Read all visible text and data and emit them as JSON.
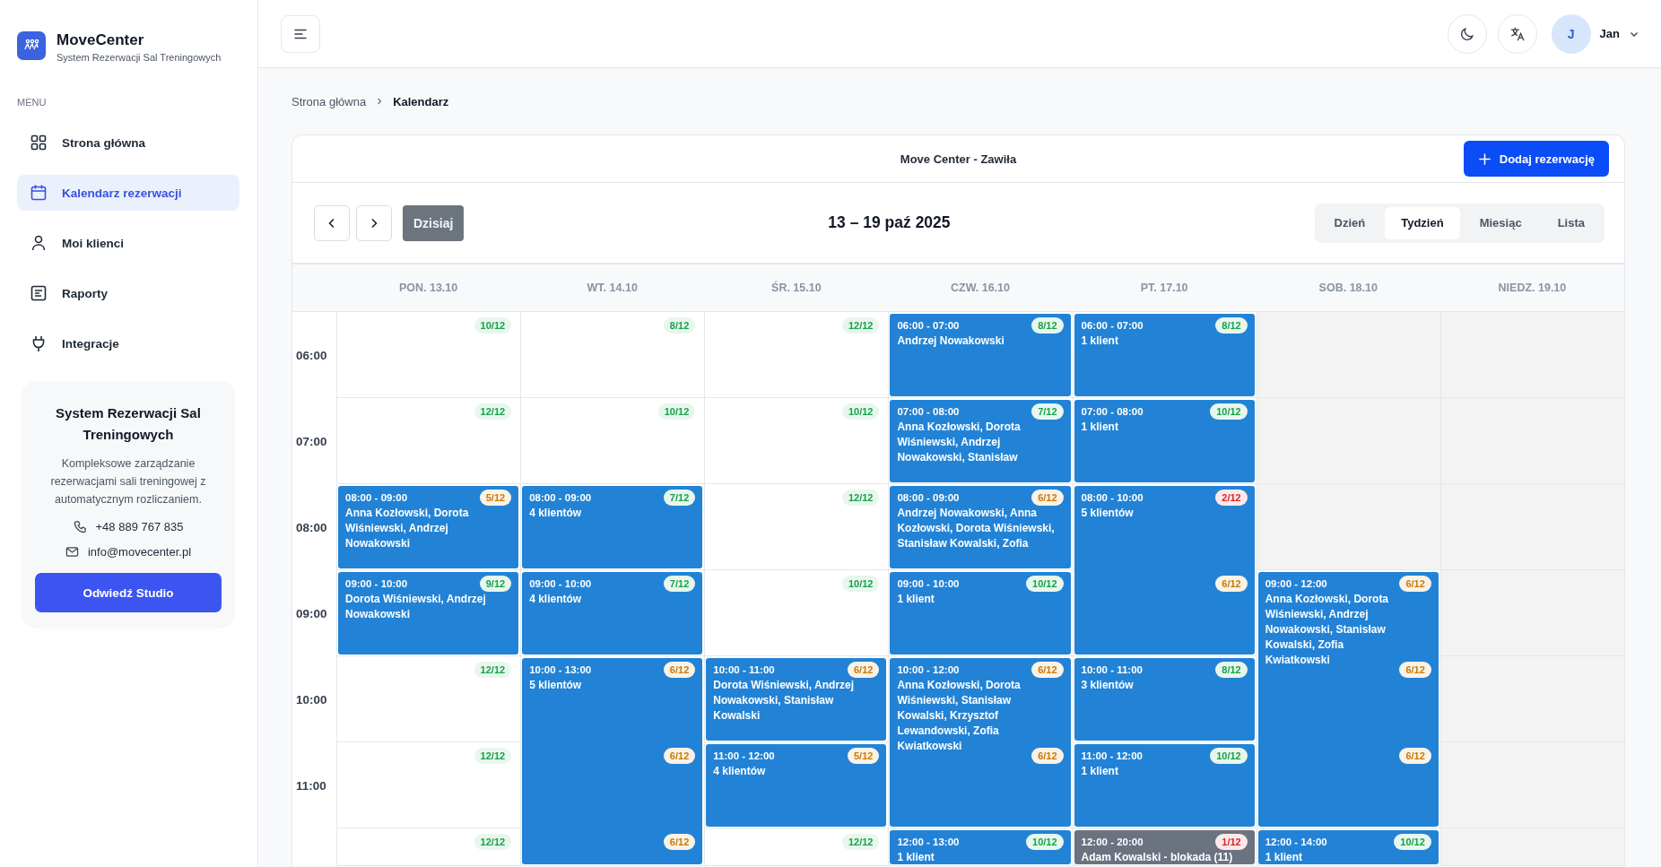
{
  "brand": {
    "name": "MoveCenter",
    "tagline": "System Rezerwacji Sal Treningowych"
  },
  "menu_label": "MENU",
  "nav": [
    {
      "label": "Strona główna",
      "selected": false
    },
    {
      "label": "Kalendarz rezerwacji",
      "selected": true
    },
    {
      "label": "Moi klienci",
      "selected": false
    },
    {
      "label": "Raporty",
      "selected": false
    },
    {
      "label": "Integracje",
      "selected": false
    }
  ],
  "info_card": {
    "title": "System Rezerwacji Sal Treningowych",
    "description": "Kompleksowe zarządzanie rezerwacjami sali treningowej z automatycznym rozliczaniem.",
    "phone": "+48 889 767 835",
    "email": "info@movecenter.pl",
    "button": "Odwiedź Studio"
  },
  "user": {
    "initial": "J",
    "name": "Jan"
  },
  "breadcrumb": [
    {
      "label": "Strona główna",
      "current": false
    },
    {
      "label": "Kalendarz",
      "current": true
    }
  ],
  "calendar": {
    "location": "Move Center - Zawiła",
    "add_button": "Dodaj rezerwację",
    "today_button": {
      "label": "Dzisiaj",
      "disabled": true
    },
    "range": "13 – 19 paź 2025",
    "views": [
      {
        "label": "Dzień",
        "selected": false
      },
      {
        "label": "Tydzień",
        "selected": true
      },
      {
        "label": "Miesiąc",
        "selected": false
      },
      {
        "label": "Lista",
        "selected": false
      }
    ],
    "hours": [
      "06:00",
      "07:00",
      "08:00",
      "09:00",
      "10:00",
      "11:00"
    ],
    "days": [
      {
        "label": "PON. 13.10",
        "slots": [
          {
            "available": true,
            "badge": "10/12",
            "color": "#16a34a"
          },
          {
            "available": true,
            "badge": "12/12",
            "color": "#16a34a"
          },
          {
            "available": true,
            "badge": "5/12",
            "color": "#c97a06"
          },
          {
            "available": true,
            "badge": "9/12",
            "color": "#16a34a"
          },
          {
            "available": true,
            "badge": "12/12",
            "color": "#16a34a"
          },
          {
            "available": true,
            "badge": "12/12",
            "color": "#16a34a"
          },
          {
            "available": true,
            "badge": "12/12",
            "color": "#16a34a"
          }
        ],
        "events": [
          {
            "kind": "booking",
            "time": "08:00 - 09:00",
            "clients": "Anna Kozłowski, Dorota Wiśniewski, Andrzej Nowakowski"
          },
          {
            "kind": "booking",
            "time": "09:00 - 10:00",
            "clients": "Dorota Wiśniewski, Andrzej Nowakowski"
          }
        ]
      },
      {
        "label": "WT. 14.10",
        "slots": [
          {
            "available": true,
            "badge": "8/12",
            "color": "#16a34a"
          },
          {
            "available": true,
            "badge": "10/12",
            "color": "#16a34a"
          },
          {
            "available": true,
            "badge": "7/12",
            "color": "#16a34a"
          },
          {
            "available": true,
            "badge": "7/12",
            "color": "#16a34a"
          },
          {
            "available": true,
            "badge": "6/12",
            "color": "#c97a06"
          },
          {
            "available": true,
            "badge": "6/12",
            "color": "#c97a06"
          },
          {
            "available": true,
            "badge": "6/12",
            "color": "#c97a06"
          }
        ],
        "events": [
          {
            "kind": "booking",
            "time": "08:00 - 09:00",
            "clients": "4 klientów"
          },
          {
            "kind": "booking",
            "time": "09:00 - 10:00",
            "clients": "4 klientów"
          },
          {
            "kind": "booking",
            "time": "10:00 - 13:00",
            "clients": "5 klientów"
          }
        ]
      },
      {
        "label": "ŚR. 15.10",
        "slots": [
          {
            "available": true,
            "badge": "12/12",
            "color": "#16a34a"
          },
          {
            "available": true,
            "badge": "10/12",
            "color": "#16a34a"
          },
          {
            "available": true,
            "badge": "12/12",
            "color": "#16a34a"
          },
          {
            "available": true,
            "badge": "10/12",
            "color": "#16a34a"
          },
          {
            "available": true,
            "badge": "6/12",
            "color": "#c97a06"
          },
          {
            "available": true,
            "badge": "5/12",
            "color": "#c97a06"
          },
          {
            "available": true,
            "badge": "12/12",
            "color": "#16a34a"
          }
        ],
        "events": [
          {
            "kind": "booking",
            "time": "10:00 - 11:00",
            "clients": "Dorota Wiśniewski, Andrzej Nowakowski, Stanisław Kowalski"
          },
          {
            "kind": "booking",
            "time": "11:00 - 12:00",
            "clients": "4 klientów"
          }
        ]
      },
      {
        "label": "CZW. 16.10",
        "slots": [
          {
            "available": true,
            "badge": "8/12",
            "color": "#16a34a"
          },
          {
            "available": true,
            "badge": "7/12",
            "color": "#16a34a"
          },
          {
            "available": true,
            "badge": "6/12",
            "color": "#c97a06"
          },
          {
            "available": true,
            "badge": "10/12",
            "color": "#16a34a"
          },
          {
            "available": true,
            "badge": "6/12",
            "color": "#c97a06"
          },
          {
            "available": true,
            "badge": "6/12",
            "color": "#c97a06"
          },
          {
            "available": true,
            "badge": "10/12",
            "color": "#16a34a"
          }
        ],
        "events": [
          {
            "kind": "booking",
            "time": "06:00 - 07:00",
            "clients": "Andrzej Nowakowski"
          },
          {
            "kind": "booking",
            "time": "07:00 - 08:00",
            "clients": "Anna Kozłowski, Dorota Wiśniewski, Andrzej Nowakowski, Stanisław"
          },
          {
            "kind": "booking",
            "time": "08:00 - 09:00",
            "clients": "Andrzej Nowakowski, Anna Kozłowski, Dorota Wiśniewski, Stanisław Kowalski, Zofia"
          },
          {
            "kind": "booking",
            "time": "09:00 - 10:00",
            "clients": "1 klient"
          },
          {
            "kind": "booking",
            "time": "10:00 - 12:00",
            "clients": "Anna Kozłowski, Dorota Wiśniewski, Stanisław Kowalski, Krzysztof Lewandowski, Zofia Kwiatkowski"
          },
          {
            "kind": "booking",
            "time": "12:00 - 13:00",
            "clients": "1 klient"
          }
        ]
      },
      {
        "label": "PT. 17.10",
        "slots": [
          {
            "available": true,
            "badge": "8/12",
            "color": "#16a34a"
          },
          {
            "available": true,
            "badge": "10/12",
            "color": "#16a34a"
          },
          {
            "available": true,
            "badge": "2/12",
            "color": "#dc2626"
          },
          {
            "available": true,
            "badge": "6/12",
            "color": "#c97a06"
          },
          {
            "available": true,
            "badge": "8/12",
            "color": "#16a34a"
          },
          {
            "available": true,
            "badge": "10/12",
            "color": "#16a34a"
          },
          {
            "available": true,
            "badge": "1/12",
            "color": "#dc2626"
          }
        ],
        "events": [
          {
            "kind": "booking",
            "time": "06:00 - 07:00",
            "clients": "1 klient"
          },
          {
            "kind": "booking",
            "time": "07:00 - 08:00",
            "clients": "1 klient"
          },
          {
            "kind": "booking",
            "time": "08:00 - 10:00",
            "clients": "5 klientów"
          },
          {
            "kind": "booking",
            "time": "10:00 - 11:00",
            "clients": "3 klientów"
          },
          {
            "kind": "booking",
            "time": "11:00 - 12:00",
            "clients": "1 klient"
          },
          {
            "kind": "block",
            "time": "12:00 - 20:00",
            "clients": "Adam Kowalski - blokada (11)"
          }
        ]
      },
      {
        "label": "SOB. 18.10",
        "slots": [
          {
            "available": false
          },
          {
            "available": false
          },
          {
            "available": false
          },
          {
            "available": true,
            "badge": "6/12",
            "color": "#c97a06"
          },
          {
            "available": true,
            "badge": "6/12",
            "color": "#c97a06"
          },
          {
            "available": true,
            "badge": "6/12",
            "color": "#c97a06"
          },
          {
            "available": true,
            "badge": "10/12",
            "color": "#16a34a"
          }
        ],
        "events": [
          {
            "kind": "booking",
            "time": "09:00 - 12:00",
            "clients": "Anna Kozłowski, Dorota Wiśniewski, Andrzej Nowakowski, Stanisław Kowalski, Zofia Kwiatkowski"
          },
          {
            "kind": "booking",
            "time": "12:00 - 14:00",
            "clients": "1 klient"
          }
        ]
      },
      {
        "label": "NIEDZ. 19.10",
        "slots": [
          {
            "available": false
          },
          {
            "available": false
          },
          {
            "available": false
          },
          {
            "available": false
          },
          {
            "available": false
          },
          {
            "available": false
          },
          {
            "available": false
          }
        ]
      }
    ]
  }
}
